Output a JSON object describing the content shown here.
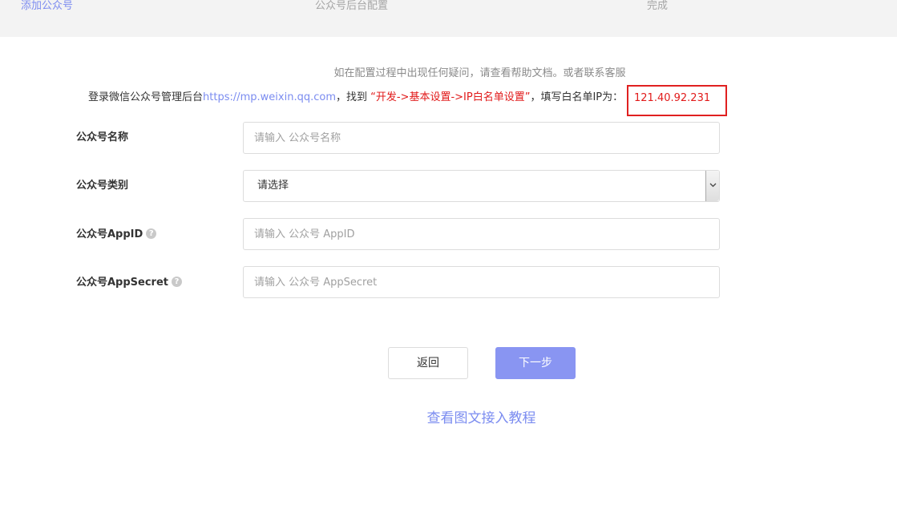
{
  "steps": [
    {
      "label": "添加公众号"
    },
    {
      "label": "公众号后台配置"
    },
    {
      "label": "完成"
    }
  ],
  "help_text": "如在配置过程中出现任何疑问，请查看帮助文档。或者联系客服",
  "login_line": {
    "prefix": "登录微信公众号管理后台",
    "url": "https://mp.weixin.qq.com",
    "middle": "，找到 ",
    "path": "“开发->基本设置->IP白名单设置”",
    "suffix": "，填写白名单IP为：",
    "ip": "121.40.92.231"
  },
  "form": {
    "name": {
      "label": "公众号名称",
      "placeholder": "请输入 公众号名称"
    },
    "category": {
      "label": "公众号类别",
      "value": "请选择"
    },
    "appid": {
      "label": "公众号AppID",
      "placeholder": "请输入 公众号 AppID",
      "help_glyph": "?"
    },
    "appsecret": {
      "label": "公众号AppSecret",
      "placeholder": "请输入 公众号 AppSecret",
      "help_glyph": "?"
    }
  },
  "buttons": {
    "back": "返回",
    "next": "下一步"
  },
  "tutorial_link": "查看图文接入教程",
  "colors": {
    "accent": "#7d8cf0",
    "primary_button": "#8995f2",
    "highlight_red": "#e11a1a",
    "step_bar_bg": "#f3f3f3"
  },
  "icons": {
    "help": "question-circle-icon",
    "select": "chevron-down-icon"
  }
}
